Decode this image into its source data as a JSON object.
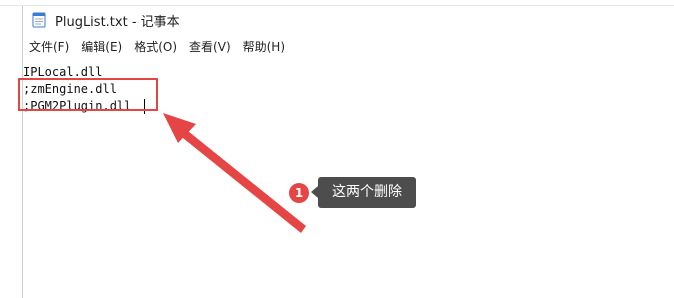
{
  "window": {
    "title": "PlugList.txt - 记事本"
  },
  "menubar": {
    "items": [
      {
        "label": "文件(F)"
      },
      {
        "label": "编辑(E)"
      },
      {
        "label": "格式(O)"
      },
      {
        "label": "查看(V)"
      },
      {
        "label": "帮助(H)"
      }
    ]
  },
  "editor": {
    "lines": [
      "IPLocal.dll",
      ";zmEngine.dll",
      ";PGM2Plugin.dll"
    ]
  },
  "annotation": {
    "step_number": "1",
    "callout_text": "这两个删除",
    "accent_color": "#e64545",
    "callout_bg": "#4d4d4d"
  }
}
